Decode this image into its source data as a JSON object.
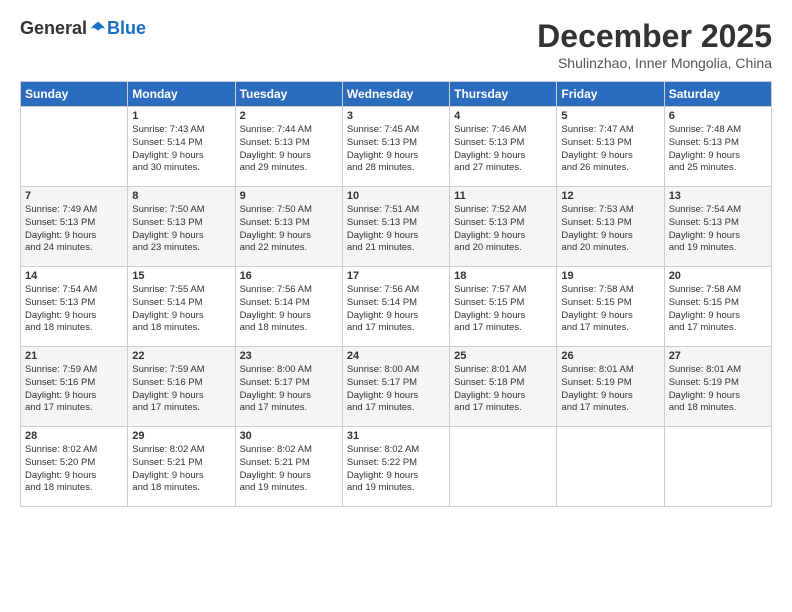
{
  "header": {
    "logo_general": "General",
    "logo_blue": "Blue",
    "month_title": "December 2025",
    "location": "Shulinzhao, Inner Mongolia, China"
  },
  "days_of_week": [
    "Sunday",
    "Monday",
    "Tuesday",
    "Wednesday",
    "Thursday",
    "Friday",
    "Saturday"
  ],
  "weeks": [
    {
      "shaded": false,
      "days": [
        {
          "date": "",
          "info": ""
        },
        {
          "date": "1",
          "info": "Sunrise: 7:43 AM\nSunset: 5:14 PM\nDaylight: 9 hours\nand 30 minutes."
        },
        {
          "date": "2",
          "info": "Sunrise: 7:44 AM\nSunset: 5:13 PM\nDaylight: 9 hours\nand 29 minutes."
        },
        {
          "date": "3",
          "info": "Sunrise: 7:45 AM\nSunset: 5:13 PM\nDaylight: 9 hours\nand 28 minutes."
        },
        {
          "date": "4",
          "info": "Sunrise: 7:46 AM\nSunset: 5:13 PM\nDaylight: 9 hours\nand 27 minutes."
        },
        {
          "date": "5",
          "info": "Sunrise: 7:47 AM\nSunset: 5:13 PM\nDaylight: 9 hours\nand 26 minutes."
        },
        {
          "date": "6",
          "info": "Sunrise: 7:48 AM\nSunset: 5:13 PM\nDaylight: 9 hours\nand 25 minutes."
        }
      ]
    },
    {
      "shaded": true,
      "days": [
        {
          "date": "7",
          "info": "Sunrise: 7:49 AM\nSunset: 5:13 PM\nDaylight: 9 hours\nand 24 minutes."
        },
        {
          "date": "8",
          "info": "Sunrise: 7:50 AM\nSunset: 5:13 PM\nDaylight: 9 hours\nand 23 minutes."
        },
        {
          "date": "9",
          "info": "Sunrise: 7:50 AM\nSunset: 5:13 PM\nDaylight: 9 hours\nand 22 minutes."
        },
        {
          "date": "10",
          "info": "Sunrise: 7:51 AM\nSunset: 5:13 PM\nDaylight: 9 hours\nand 21 minutes."
        },
        {
          "date": "11",
          "info": "Sunrise: 7:52 AM\nSunset: 5:13 PM\nDaylight: 9 hours\nand 20 minutes."
        },
        {
          "date": "12",
          "info": "Sunrise: 7:53 AM\nSunset: 5:13 PM\nDaylight: 9 hours\nand 20 minutes."
        },
        {
          "date": "13",
          "info": "Sunrise: 7:54 AM\nSunset: 5:13 PM\nDaylight: 9 hours\nand 19 minutes."
        }
      ]
    },
    {
      "shaded": false,
      "days": [
        {
          "date": "14",
          "info": "Sunrise: 7:54 AM\nSunset: 5:13 PM\nDaylight: 9 hours\nand 18 minutes."
        },
        {
          "date": "15",
          "info": "Sunrise: 7:55 AM\nSunset: 5:14 PM\nDaylight: 9 hours\nand 18 minutes."
        },
        {
          "date": "16",
          "info": "Sunrise: 7:56 AM\nSunset: 5:14 PM\nDaylight: 9 hours\nand 18 minutes."
        },
        {
          "date": "17",
          "info": "Sunrise: 7:56 AM\nSunset: 5:14 PM\nDaylight: 9 hours\nand 17 minutes."
        },
        {
          "date": "18",
          "info": "Sunrise: 7:57 AM\nSunset: 5:15 PM\nDaylight: 9 hours\nand 17 minutes."
        },
        {
          "date": "19",
          "info": "Sunrise: 7:58 AM\nSunset: 5:15 PM\nDaylight: 9 hours\nand 17 minutes."
        },
        {
          "date": "20",
          "info": "Sunrise: 7:58 AM\nSunset: 5:15 PM\nDaylight: 9 hours\nand 17 minutes."
        }
      ]
    },
    {
      "shaded": true,
      "days": [
        {
          "date": "21",
          "info": "Sunrise: 7:59 AM\nSunset: 5:16 PM\nDaylight: 9 hours\nand 17 minutes."
        },
        {
          "date": "22",
          "info": "Sunrise: 7:59 AM\nSunset: 5:16 PM\nDaylight: 9 hours\nand 17 minutes."
        },
        {
          "date": "23",
          "info": "Sunrise: 8:00 AM\nSunset: 5:17 PM\nDaylight: 9 hours\nand 17 minutes."
        },
        {
          "date": "24",
          "info": "Sunrise: 8:00 AM\nSunset: 5:17 PM\nDaylight: 9 hours\nand 17 minutes."
        },
        {
          "date": "25",
          "info": "Sunrise: 8:01 AM\nSunset: 5:18 PM\nDaylight: 9 hours\nand 17 minutes."
        },
        {
          "date": "26",
          "info": "Sunrise: 8:01 AM\nSunset: 5:19 PM\nDaylight: 9 hours\nand 17 minutes."
        },
        {
          "date": "27",
          "info": "Sunrise: 8:01 AM\nSunset: 5:19 PM\nDaylight: 9 hours\nand 18 minutes."
        }
      ]
    },
    {
      "shaded": false,
      "days": [
        {
          "date": "28",
          "info": "Sunrise: 8:02 AM\nSunset: 5:20 PM\nDaylight: 9 hours\nand 18 minutes."
        },
        {
          "date": "29",
          "info": "Sunrise: 8:02 AM\nSunset: 5:21 PM\nDaylight: 9 hours\nand 18 minutes."
        },
        {
          "date": "30",
          "info": "Sunrise: 8:02 AM\nSunset: 5:21 PM\nDaylight: 9 hours\nand 19 minutes."
        },
        {
          "date": "31",
          "info": "Sunrise: 8:02 AM\nSunset: 5:22 PM\nDaylight: 9 hours\nand 19 minutes."
        },
        {
          "date": "",
          "info": ""
        },
        {
          "date": "",
          "info": ""
        },
        {
          "date": "",
          "info": ""
        }
      ]
    }
  ]
}
